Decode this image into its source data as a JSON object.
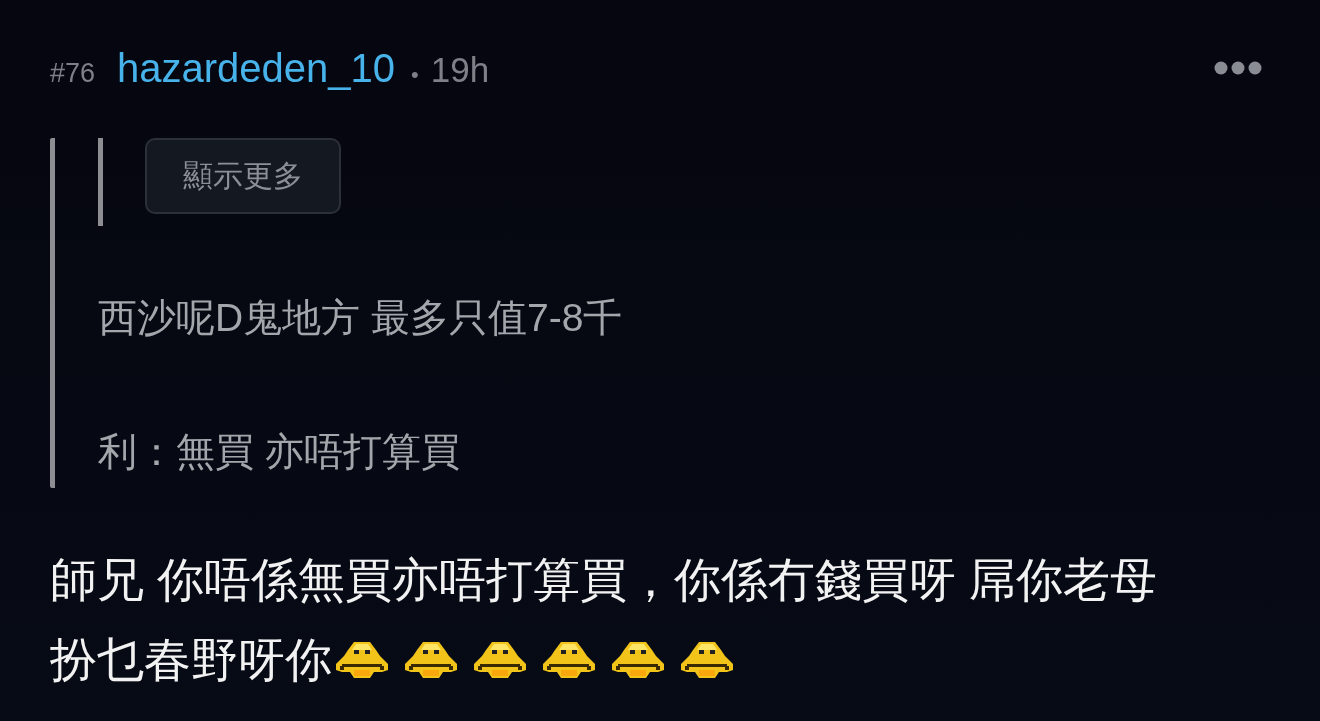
{
  "post": {
    "number": "#76",
    "username": "hazardeden_10",
    "separator": "•",
    "time": "19h"
  },
  "quote": {
    "nested_quote": {
      "show_more_label": "顯示更多"
    },
    "lines": [
      "西沙呢D鬼地方 最多只值7-8千",
      "利：無買 亦唔打算買"
    ]
  },
  "body": {
    "lines": [
      "師兄 你唔係無買亦唔打算買，你係冇錢買呀 屌你老母",
      "扮乜春野呀你"
    ],
    "emoticons": [
      {
        "kind": "frown"
      },
      {
        "kind": "frown"
      },
      {
        "kind": "frown"
      },
      {
        "kind": "frown"
      },
      {
        "kind": "frown"
      },
      {
        "kind": "frown"
      }
    ]
  }
}
